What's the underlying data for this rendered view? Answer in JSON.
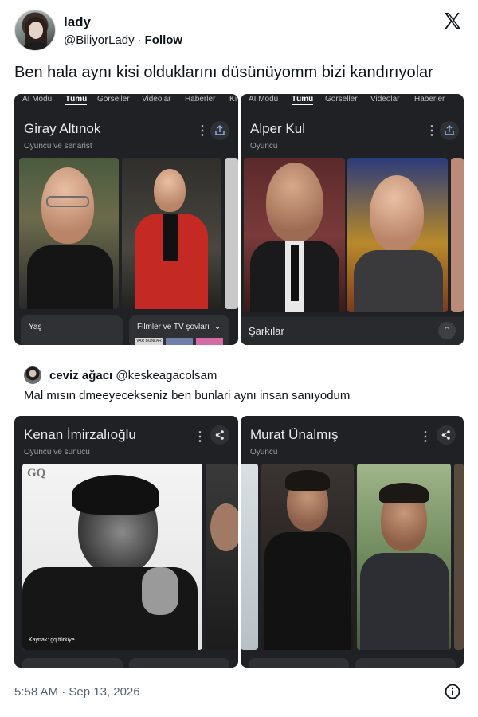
{
  "tweet": {
    "author_name": "lady",
    "author_handle": "@BiliyorLady",
    "separator": "·",
    "follow_label": "Follow",
    "text": "Ben hala aynı kisi olduklarını düsünüyomm bizi kandırıyolar",
    "timestamp": "5:58 AM · Sep 13, 2026"
  },
  "tabs": [
    "AI Modu",
    "Tümü",
    "Görseller",
    "Videolar",
    "Haberler",
    "Kı"
  ],
  "panels_top": [
    {
      "title": "Giray Altınok",
      "subtitle": "Oyuncu ve senarist",
      "cards": [
        "Yaş",
        "Filmler ve TV şovları"
      ],
      "thumb_label": "VAR BUNLAR"
    },
    {
      "title": "Alper Kul",
      "subtitle": "Oyuncu",
      "cards": [
        "Şarkılar"
      ]
    }
  ],
  "quote": {
    "author_name": "ceviz ağacı",
    "author_handle": "@keskeagacolsam",
    "text": "Mal mısın dmeeyecekseniz ben bunlari aynı insan sanıyodum"
  },
  "panels_bottom": [
    {
      "title": "Kenan İmirzalıoğlu",
      "subtitle": "Oyuncu ve sunucu",
      "magazine_logo": "GQ",
      "caption": "Kaynak: gq türkiye"
    },
    {
      "title": "Murat Ünalmış",
      "subtitle": "Oyuncu"
    }
  ],
  "colors": {
    "panel_bg": "#202124",
    "card_bg": "#303134",
    "text_primary": "#0f1419",
    "text_secondary": "#536471"
  }
}
